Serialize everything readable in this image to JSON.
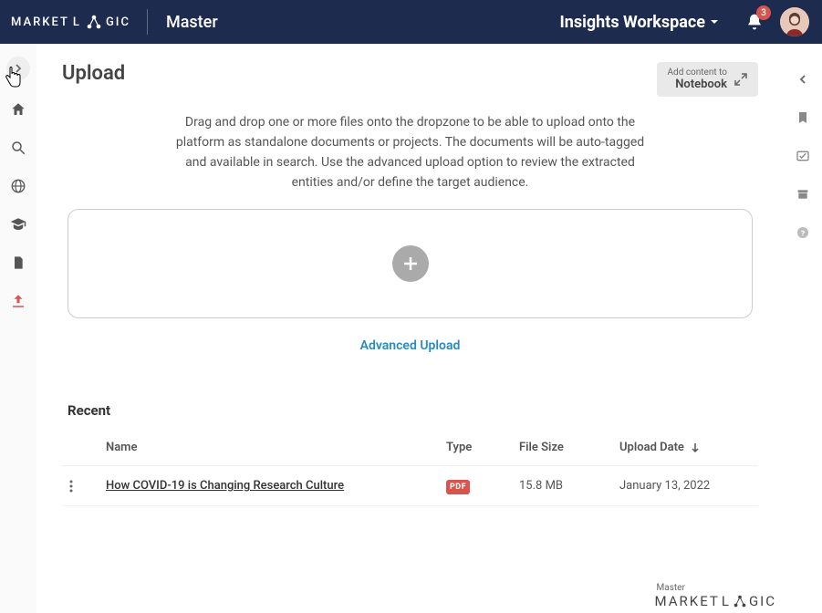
{
  "header": {
    "brand_a": "MARKET",
    "brand_b": "L",
    "brand_c": "GIC",
    "workspace": "Master",
    "insights": "Insights Workspace",
    "notif_count": "3"
  },
  "page": {
    "title": "Upload",
    "notebook_line1": "Add content to",
    "notebook_line2": "Notebook",
    "instructions": "Drag and drop one or more files onto the dropzone to be able to upload onto the platform as standalone documents or projects. The documents will be auto-tagged and available in search. Use the advanced upload option to review the extracted entities and/or define the target audience.",
    "advanced_link": "Advanced Upload",
    "recent_title": "Recent"
  },
  "table": {
    "cols": {
      "name": "Name",
      "type": "Type",
      "size": "File Size",
      "date": "Upload Date"
    },
    "rows": [
      {
        "name": "How COVID-19 is Changing Research Culture",
        "type": "PDF",
        "size": "15.8 MB",
        "date": "January 13, 2022"
      }
    ]
  },
  "footer": {
    "small": "Master",
    "a": "MARKET",
    "b": "L",
    "c": "GIC"
  }
}
